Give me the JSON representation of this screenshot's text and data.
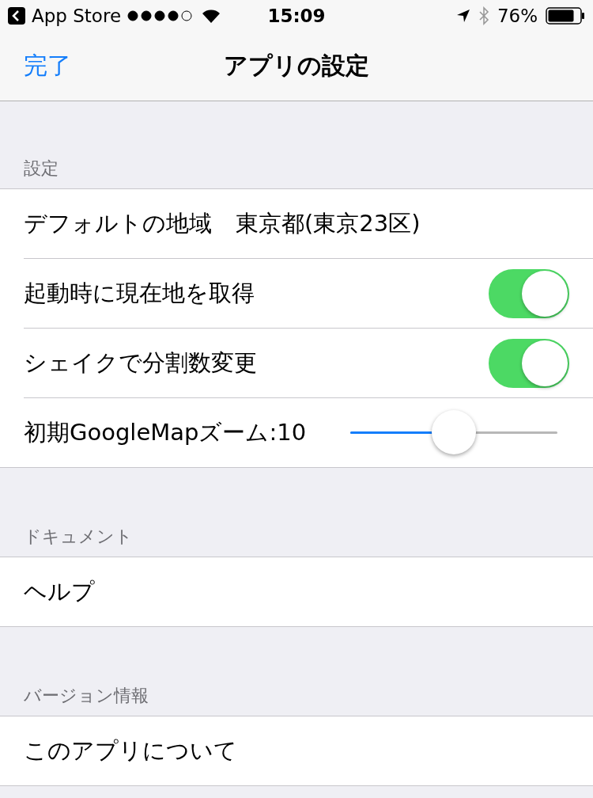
{
  "status_bar": {
    "back_app": "App Store",
    "time": "15:09",
    "battery": "76%"
  },
  "nav_bar": {
    "done": "完了",
    "title": "アプリの設定"
  },
  "sections": [
    {
      "header": "設定",
      "rows": [
        {
          "kind": "value",
          "label": "デフォルトの地域",
          "value": "東京都(東京23区)"
        },
        {
          "kind": "toggle",
          "label": "起動時に現在地を取得",
          "on": true
        },
        {
          "kind": "toggle",
          "label": "シェイクで分割数変更",
          "on": true
        },
        {
          "kind": "slider",
          "label": "初期GoogleMapズーム:10",
          "level": 0.5
        }
      ]
    },
    {
      "header": "ドキュメント",
      "rows": [
        {
          "kind": "link",
          "label": "ヘルプ"
        }
      ]
    },
    {
      "header": "バージョン情報",
      "rows": [
        {
          "kind": "link",
          "label": "このアプリについて"
        }
      ]
    }
  ]
}
